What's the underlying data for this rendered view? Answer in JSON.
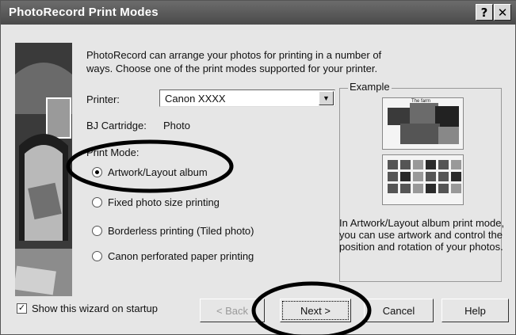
{
  "window": {
    "title": "PhotoRecord Print Modes"
  },
  "titlebar": {
    "help_label": "?",
    "close_label": "✕"
  },
  "intro_text": "PhotoRecord can arrange your photos for printing in a number of ways. Choose one of the print modes supported for your printer.",
  "printer": {
    "label": "Printer:",
    "value": "Canon XXXX",
    "dropdown_icon": "▼"
  },
  "cartridge": {
    "label": "BJ Cartridge:",
    "value": "Photo"
  },
  "print_mode": {
    "label": "Print Mode:",
    "options": [
      {
        "label": "Artwork/Layout album",
        "checked": true
      },
      {
        "label": "Fixed photo size printing",
        "checked": false
      },
      {
        "label": "Borderless printing (Tiled photo)",
        "checked": false
      },
      {
        "label": "Canon perforated paper printing",
        "checked": false
      }
    ]
  },
  "example": {
    "legend": "Example",
    "thumb_title": "The farm",
    "description": "In Artwork/Layout album print mode, you can use artwork and control the position and rotation of your photos."
  },
  "startup_checkbox": {
    "label": "Show this wizard on startup",
    "checked": true,
    "mark": "✓"
  },
  "buttons": {
    "back": "< Back",
    "next": "Next >",
    "cancel": "Cancel",
    "help": "Help"
  }
}
